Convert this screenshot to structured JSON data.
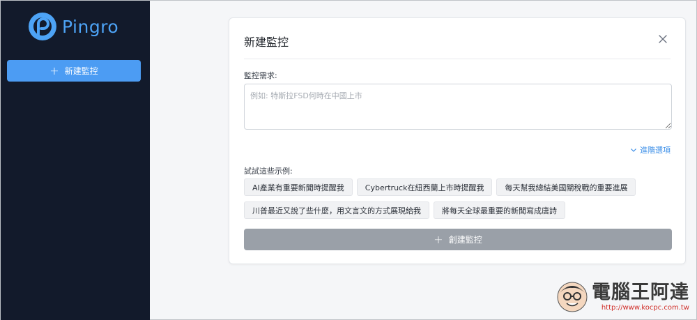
{
  "sidebar": {
    "brand": "Pingro",
    "new_button_label": "新建監控"
  },
  "dialog": {
    "title": "新建監控",
    "requirement_label": "監控需求:",
    "requirement_placeholder": "例如: 特斯拉FSD何時在中國上市",
    "requirement_value": "",
    "advanced_label": "進階選項",
    "examples_label": "試試這些示例:",
    "examples": [
      "AI產業有重要新聞時提醒我",
      "Cybertruck在紐西蘭上市時提醒我",
      "每天幫我總結美國關稅戰的重要進展",
      "川普最近又說了些什麼，用文言文的方式展現給我",
      "將每天全球最重要的新聞寫成唐詩"
    ],
    "create_button_label": "創建監控"
  },
  "watermark": {
    "title": "電腦王阿達",
    "url": "http://www.kocpc.com.tw"
  },
  "colors": {
    "sidebar_bg": "#121a2b",
    "accent": "#4c9cf3",
    "disabled_button": "#9aa0a8"
  }
}
